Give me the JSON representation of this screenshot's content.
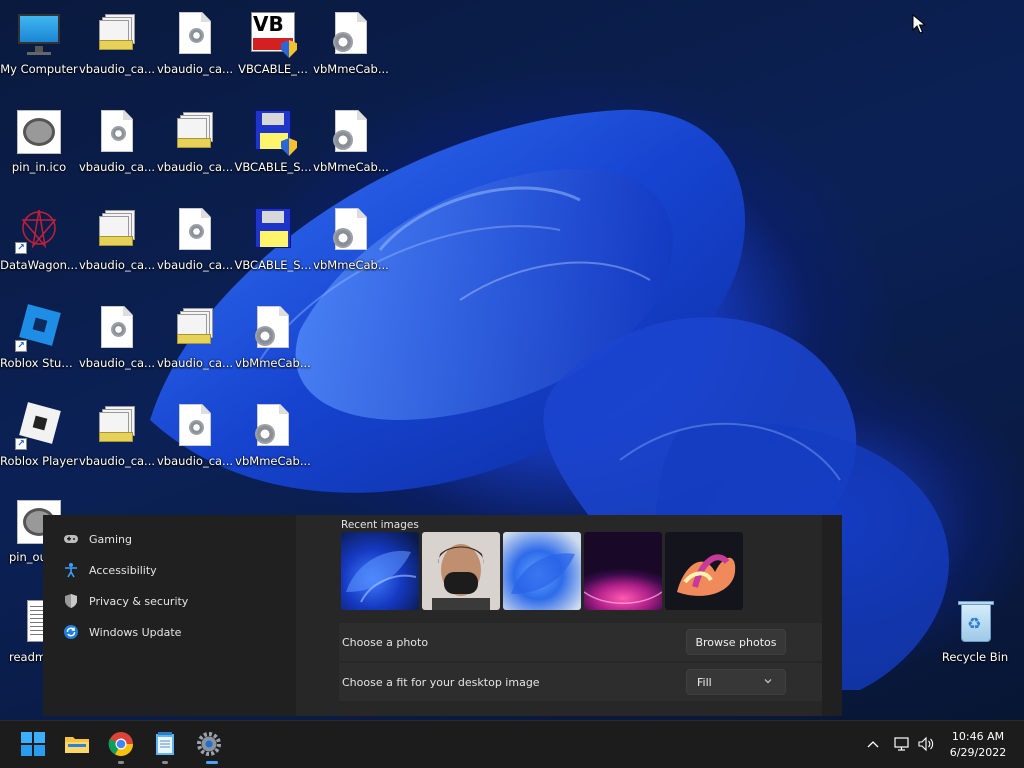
{
  "desktop": {
    "icons": [
      {
        "label": "My Computer",
        "kind": "monitor-icon"
      },
      {
        "label": "vbaudio_ca...",
        "kind": "stack-file-icon"
      },
      {
        "label": "vbaudio_ca...",
        "kind": "settings-file-icon"
      },
      {
        "label": "VBCABLE_...",
        "kind": "vb-audio-icon"
      },
      {
        "label": "vbMmeCab...",
        "kind": "settings-file-icon"
      },
      {
        "label": "pin_in.ico",
        "kind": "pin-image-icon"
      },
      {
        "label": "vbaudio_ca...",
        "kind": "settings-file-icon"
      },
      {
        "label": "vbaudio_ca...",
        "kind": "stack-file-icon"
      },
      {
        "label": "VBCABLE_S...",
        "kind": "floppy-setup-icon"
      },
      {
        "label": "vbMmeCab...",
        "kind": "settings-file-icon"
      },
      {
        "label": "DataWagon...",
        "kind": "datawagon-icon"
      },
      {
        "label": "vbaudio_ca...",
        "kind": "stack-file-icon"
      },
      {
        "label": "vbaudio_ca...",
        "kind": "settings-file-icon"
      },
      {
        "label": "VBCABLE_S...",
        "kind": "floppy-setup-icon"
      },
      {
        "label": "vbMmeCab...",
        "kind": "settings-file-icon"
      },
      {
        "label": "Roblox Studio",
        "kind": "roblox-studio-icon"
      },
      {
        "label": "vbaudio_ca...",
        "kind": "settings-file-icon"
      },
      {
        "label": "vbaudio_ca...",
        "kind": "stack-file-icon"
      },
      {
        "label": "vbMmeCab...",
        "kind": "settings-file-icon"
      },
      {
        "label": "Roblox Player",
        "kind": "roblox-player-icon"
      },
      {
        "label": "vbaudio_ca...",
        "kind": "stack-file-icon"
      },
      {
        "label": "vbaudio_ca...",
        "kind": "settings-file-icon"
      },
      {
        "label": "vbMmeCab...",
        "kind": "settings-file-icon"
      },
      {
        "label": "pin_ou...",
        "kind": "pin-image-icon"
      },
      {
        "label": "readm...",
        "kind": "text-file-icon"
      },
      {
        "label": "Recycle Bin",
        "kind": "recycle-bin-icon"
      }
    ]
  },
  "settings": {
    "nav": [
      {
        "label": "Gaming",
        "icon": "gamepad-icon"
      },
      {
        "label": "Accessibility",
        "icon": "accessibility-icon"
      },
      {
        "label": "Privacy & security",
        "icon": "shield-icon"
      },
      {
        "label": "Windows Update",
        "icon": "update-icon"
      }
    ],
    "recent_images_title": "Recent images",
    "choose_photo_label": "Choose a photo",
    "browse_button": "Browse photos",
    "choose_fit_label": "Choose a fit for your desktop image",
    "fit_value": "Fill"
  },
  "taskbar": {
    "apps": [
      "start-icon",
      "file-explorer-icon",
      "chrome-icon",
      "notepad-icon",
      "settings-icon"
    ],
    "time": "10:46 AM",
    "date": "6/29/2022"
  },
  "colors": {
    "accent": "#0067c0",
    "window_bg": "#202020",
    "content_bg": "#272727",
    "card_bg": "#2d2d2d"
  }
}
